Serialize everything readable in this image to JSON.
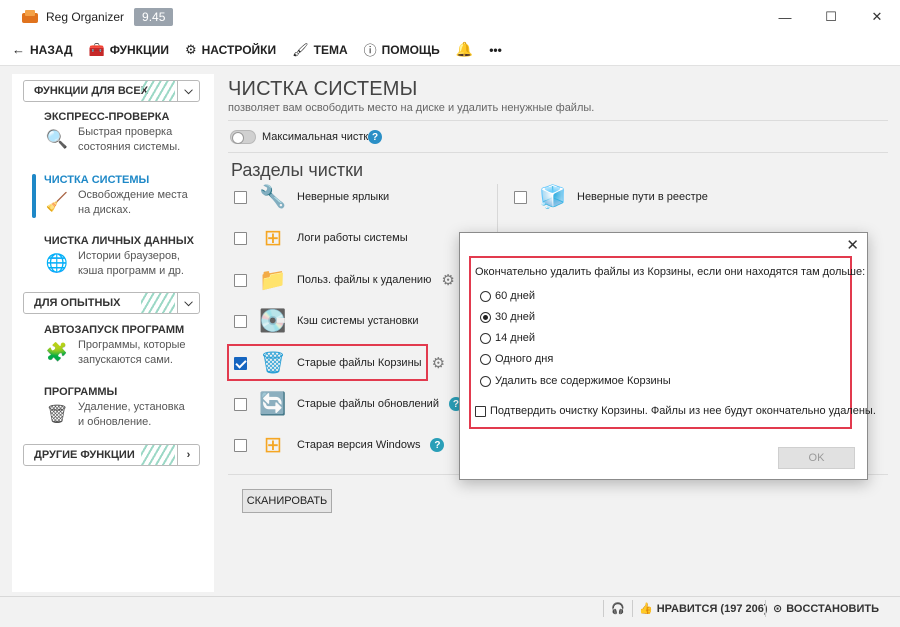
{
  "window": {
    "app_title": "Reg Organizer",
    "version": "9.45",
    "controls": {
      "minimize": "—",
      "maximize": "☐",
      "close": "✕"
    }
  },
  "toolbar": {
    "back": "НАЗАД",
    "functions": "ФУНКЦИИ",
    "settings": "НАСТРОЙКИ",
    "theme": "ТЕМА",
    "help": "ПОМОЩЬ",
    "more": "•••"
  },
  "sidebar": {
    "sections": [
      {
        "label": "ФУНКЦИИ ДЛЯ ВСЕХ",
        "chevron": "⌵"
      },
      {
        "label": "ДЛЯ ОПЫТНЫХ",
        "chevron": "⌵"
      },
      {
        "label": "ДРУГИЕ ФУНКЦИИ",
        "chevron": "›"
      }
    ],
    "items": [
      {
        "title": "ЭКСПРЕСС-ПРОВЕРКА",
        "desc1": "Быстрая проверка",
        "desc2": "состояния системы.",
        "icon": "search-check-icon"
      },
      {
        "title": "ЧИСТКА СИСТЕМЫ",
        "desc1": "Освобождение места",
        "desc2": "на дисках.",
        "icon": "disk-clean-icon"
      },
      {
        "title": "ЧИСТКА ЛИЧНЫХ ДАННЫХ",
        "desc1": "Истории браузеров,",
        "desc2": "кэша программ и др.",
        "icon": "privacy-icon"
      },
      {
        "title": "АВТОЗАПУСК ПРОГРАММ",
        "desc1": "Программы, которые",
        "desc2": "запускаются сами.",
        "icon": "startup-icon"
      },
      {
        "title": "ПРОГРАММЫ",
        "desc1": "Удаление, установка",
        "desc2": "и обновление.",
        "icon": "programs-icon"
      }
    ]
  },
  "main": {
    "title": "ЧИСТКА СИСТЕМЫ",
    "subtitle": "позволяет вам освободить место на диске и удалить ненужные файлы.",
    "max_clean_label": "Максимальная чистка",
    "sections_title": "Разделы чистки",
    "left_items": [
      {
        "label": "Неверные ярлыки",
        "checked": false,
        "extra": ""
      },
      {
        "label": "Логи работы системы",
        "checked": false,
        "extra": ""
      },
      {
        "label": "Польз. файлы к удалению",
        "checked": false,
        "extra": "gear"
      },
      {
        "label": "Кэш системы установки",
        "checked": false,
        "extra": ""
      },
      {
        "label": "Старые файлы Корзины",
        "checked": true,
        "extra": "gear"
      },
      {
        "label": "Старые файлы обновлений",
        "checked": false,
        "extra": "help"
      },
      {
        "label": "Старая версия Windows",
        "checked": false,
        "extra": "help"
      }
    ],
    "right_items": [
      {
        "label": "Неверные пути в реестре",
        "checked": false
      }
    ],
    "scan_button": "СКАНИРОВАТЬ"
  },
  "statusbar": {
    "likes": "НРАВИТСЯ (197 206)",
    "restore": "ВОССТАНОВИТЬ"
  },
  "dialog": {
    "close": "✕",
    "question": "Окончательно удалить файлы из Корзины, если они находятся там дольше:",
    "options": [
      "60 дней",
      "30 дней",
      "14 дней",
      "Одного дня",
      "Удалить все содержимое Корзины"
    ],
    "selected_index": 1,
    "confirm_label": "Подтвердить очистку Корзины. Файлы из нее будут окончательно удалены.",
    "ok_button": "OK"
  },
  "colors": {
    "accent": "#1e88c7",
    "highlight_border": "#e23a4e",
    "checkbox_checked": "#1565c0"
  }
}
